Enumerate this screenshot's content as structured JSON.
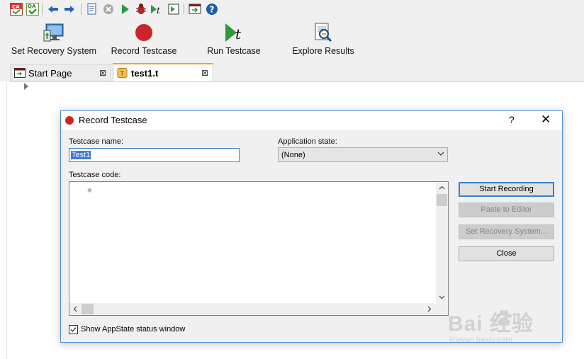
{
  "toolbar": {
    "icons": [
      "ca-icon",
      "qa-icon",
      "back-icon",
      "forward-icon",
      "new-doc-icon",
      "stop-icon",
      "run-icon",
      "debug-icon",
      "run-testcase-icon",
      "explore-icon",
      "export-icon",
      "help-icon"
    ]
  },
  "ribbon": {
    "set_recovery": "Set Recovery System",
    "record": "Record Testcase",
    "run": "Run Testcase",
    "explore": "Explore Results"
  },
  "tabs": {
    "start_page": "Start Page",
    "test_file": "test1.t"
  },
  "dialog": {
    "title": "Record Testcase",
    "help": "?",
    "close": "✕",
    "testcase_name_label": "Testcase name:",
    "testcase_name_value": "Test1",
    "app_state_label": "Application state:",
    "app_state_value": "(None)",
    "code_label": "Testcase code:",
    "buttons": {
      "start": "Start Recording",
      "paste": "Paste to Editor",
      "set_recovery": "Set Recovery System...",
      "close": "Close"
    },
    "checkbox_label": "Show AppState status window",
    "checkbox_checked": true
  },
  "watermark": {
    "text": "Bai  经验",
    "url": "jingyan.baidu.com"
  },
  "colors": {
    "accent_blue": "#3c7fc4",
    "record_red": "#c8262a",
    "run_green": "#2e9a3a"
  }
}
